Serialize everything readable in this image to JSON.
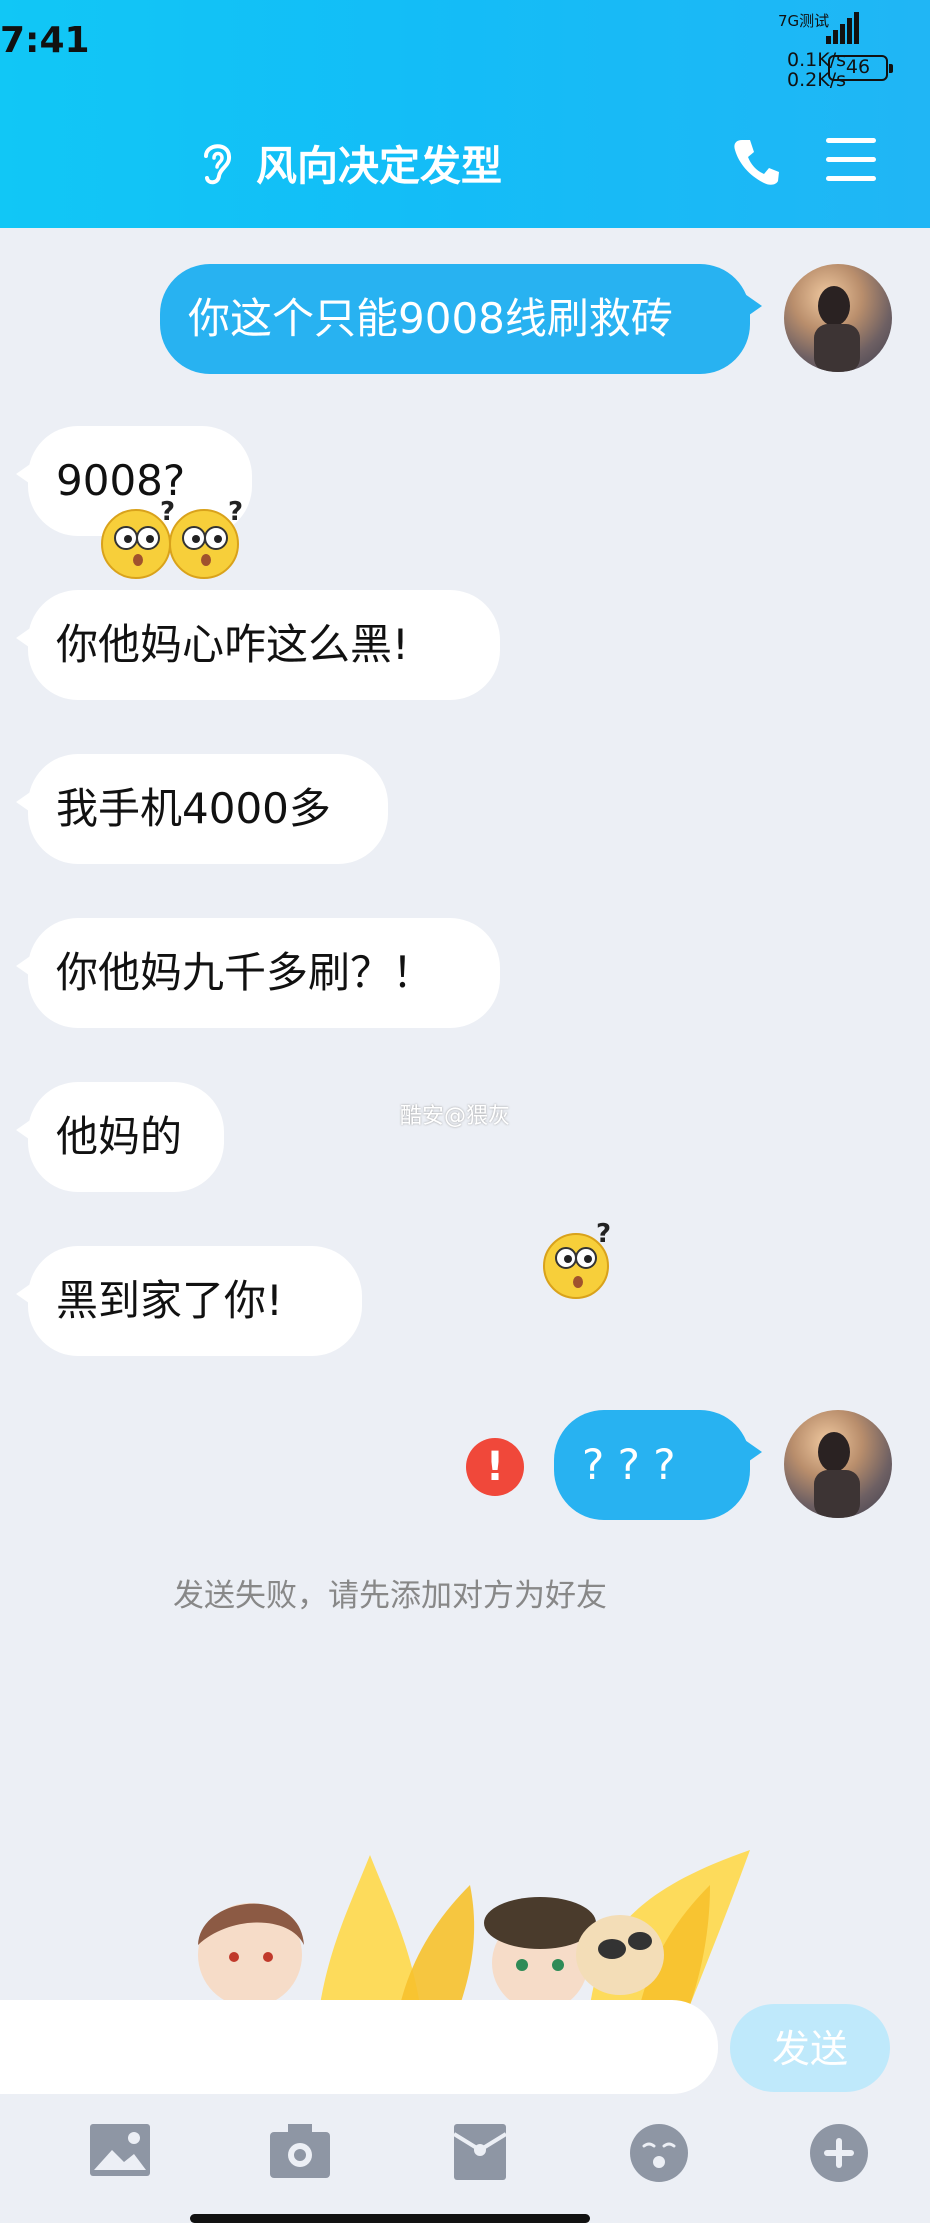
{
  "status_bar": {
    "time": "7:41",
    "network_label": "7G测试",
    "upload_speed": "0.1K/s",
    "download_speed": "0.2K/s",
    "battery": "46"
  },
  "header": {
    "title": "风向决定发型",
    "icons": [
      "ear-icon",
      "phone-icon",
      "menu-icon"
    ]
  },
  "messages": [
    {
      "side": "out",
      "text": "你这个只能9008线刷救砖"
    },
    {
      "side": "in",
      "text": "9008?"
    },
    {
      "side": "in",
      "text": "你他妈心咋这么黑!"
    },
    {
      "side": "in",
      "text": "我手机4000多"
    },
    {
      "side": "in",
      "text": "你他妈九千多刷？！"
    },
    {
      "side": "in",
      "text": "他妈的"
    },
    {
      "side": "in",
      "text": "黑到家了你!"
    },
    {
      "side": "out",
      "text": "? ? ?",
      "failed": true
    }
  ],
  "error_badge": "!",
  "system_notice": "发送失败，请先添加对方为好友",
  "watermark": "酷安@猥灰",
  "composer": {
    "send_label": "发送",
    "toolbar_icons": [
      "image-icon",
      "camera-icon",
      "red-packet-icon",
      "emoji-icon",
      "plus-icon"
    ]
  },
  "colors": {
    "header_gradient": [
      "#11c7f6",
      "#20b6f5"
    ],
    "outgoing_bubble": "#28b2f1",
    "incoming_bubble": "#ffffff",
    "background": "#eceff5",
    "error": "#f0483a",
    "send_disabled": "#bfe9fb"
  }
}
